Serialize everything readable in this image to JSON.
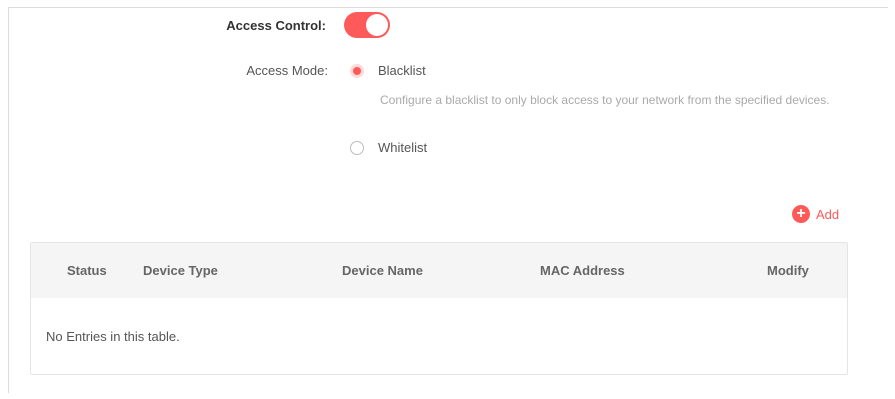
{
  "access_control": {
    "label": "Access Control:",
    "enabled": true
  },
  "access_mode": {
    "label": "Access Mode:",
    "options": [
      {
        "label": "Blacklist",
        "selected": true
      },
      {
        "label": "Whitelist",
        "selected": false
      }
    ],
    "blacklist_description": "Configure a blacklist to only block access to your network from the specified devices."
  },
  "add_label": "Add",
  "table": {
    "columns": [
      "Status",
      "Device Type",
      "Device Name",
      "MAC Address",
      "Modify"
    ],
    "empty_message": "No Entries in this table."
  },
  "colors": {
    "accent": "#ff5a5a",
    "header_bg": "#f5f5f5"
  },
  "icons": {
    "add": "plus-circle-icon"
  }
}
